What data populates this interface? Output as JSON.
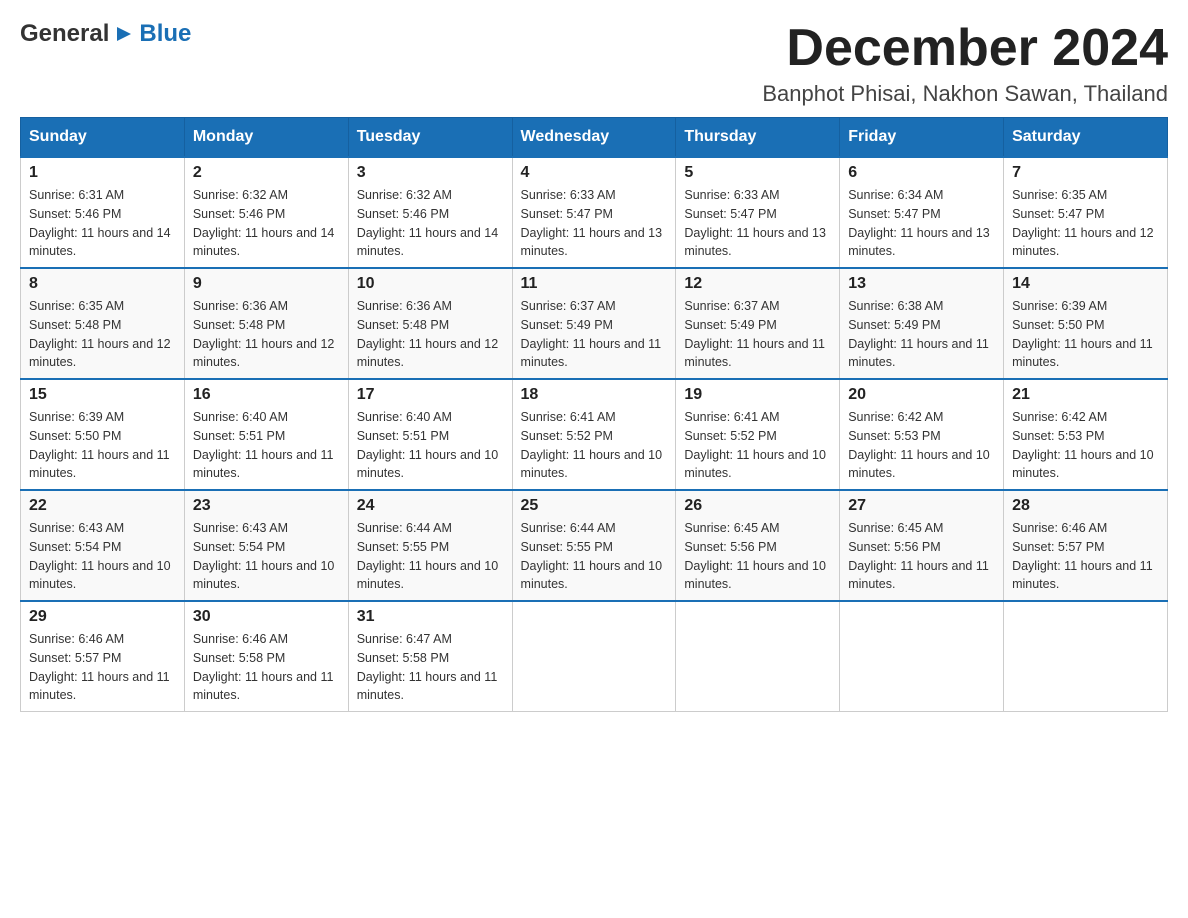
{
  "header": {
    "logo_general": "General",
    "logo_triangle": "▶",
    "logo_blue": "Blue",
    "month_title": "December 2024",
    "location": "Banphot Phisai, Nakhon Sawan, Thailand"
  },
  "days_of_week": [
    "Sunday",
    "Monday",
    "Tuesday",
    "Wednesday",
    "Thursday",
    "Friday",
    "Saturday"
  ],
  "weeks": [
    [
      {
        "day": "1",
        "sunrise": "6:31 AM",
        "sunset": "5:46 PM",
        "daylight": "11 hours and 14 minutes."
      },
      {
        "day": "2",
        "sunrise": "6:32 AM",
        "sunset": "5:46 PM",
        "daylight": "11 hours and 14 minutes."
      },
      {
        "day": "3",
        "sunrise": "6:32 AM",
        "sunset": "5:46 PM",
        "daylight": "11 hours and 14 minutes."
      },
      {
        "day": "4",
        "sunrise": "6:33 AM",
        "sunset": "5:47 PM",
        "daylight": "11 hours and 13 minutes."
      },
      {
        "day": "5",
        "sunrise": "6:33 AM",
        "sunset": "5:47 PM",
        "daylight": "11 hours and 13 minutes."
      },
      {
        "day": "6",
        "sunrise": "6:34 AM",
        "sunset": "5:47 PM",
        "daylight": "11 hours and 13 minutes."
      },
      {
        "day": "7",
        "sunrise": "6:35 AM",
        "sunset": "5:47 PM",
        "daylight": "11 hours and 12 minutes."
      }
    ],
    [
      {
        "day": "8",
        "sunrise": "6:35 AM",
        "sunset": "5:48 PM",
        "daylight": "11 hours and 12 minutes."
      },
      {
        "day": "9",
        "sunrise": "6:36 AM",
        "sunset": "5:48 PM",
        "daylight": "11 hours and 12 minutes."
      },
      {
        "day": "10",
        "sunrise": "6:36 AM",
        "sunset": "5:48 PM",
        "daylight": "11 hours and 12 minutes."
      },
      {
        "day": "11",
        "sunrise": "6:37 AM",
        "sunset": "5:49 PM",
        "daylight": "11 hours and 11 minutes."
      },
      {
        "day": "12",
        "sunrise": "6:37 AM",
        "sunset": "5:49 PM",
        "daylight": "11 hours and 11 minutes."
      },
      {
        "day": "13",
        "sunrise": "6:38 AM",
        "sunset": "5:49 PM",
        "daylight": "11 hours and 11 minutes."
      },
      {
        "day": "14",
        "sunrise": "6:39 AM",
        "sunset": "5:50 PM",
        "daylight": "11 hours and 11 minutes."
      }
    ],
    [
      {
        "day": "15",
        "sunrise": "6:39 AM",
        "sunset": "5:50 PM",
        "daylight": "11 hours and 11 minutes."
      },
      {
        "day": "16",
        "sunrise": "6:40 AM",
        "sunset": "5:51 PM",
        "daylight": "11 hours and 11 minutes."
      },
      {
        "day": "17",
        "sunrise": "6:40 AM",
        "sunset": "5:51 PM",
        "daylight": "11 hours and 10 minutes."
      },
      {
        "day": "18",
        "sunrise": "6:41 AM",
        "sunset": "5:52 PM",
        "daylight": "11 hours and 10 minutes."
      },
      {
        "day": "19",
        "sunrise": "6:41 AM",
        "sunset": "5:52 PM",
        "daylight": "11 hours and 10 minutes."
      },
      {
        "day": "20",
        "sunrise": "6:42 AM",
        "sunset": "5:53 PM",
        "daylight": "11 hours and 10 minutes."
      },
      {
        "day": "21",
        "sunrise": "6:42 AM",
        "sunset": "5:53 PM",
        "daylight": "11 hours and 10 minutes."
      }
    ],
    [
      {
        "day": "22",
        "sunrise": "6:43 AM",
        "sunset": "5:54 PM",
        "daylight": "11 hours and 10 minutes."
      },
      {
        "day": "23",
        "sunrise": "6:43 AM",
        "sunset": "5:54 PM",
        "daylight": "11 hours and 10 minutes."
      },
      {
        "day": "24",
        "sunrise": "6:44 AM",
        "sunset": "5:55 PM",
        "daylight": "11 hours and 10 minutes."
      },
      {
        "day": "25",
        "sunrise": "6:44 AM",
        "sunset": "5:55 PM",
        "daylight": "11 hours and 10 minutes."
      },
      {
        "day": "26",
        "sunrise": "6:45 AM",
        "sunset": "5:56 PM",
        "daylight": "11 hours and 10 minutes."
      },
      {
        "day": "27",
        "sunrise": "6:45 AM",
        "sunset": "5:56 PM",
        "daylight": "11 hours and 11 minutes."
      },
      {
        "day": "28",
        "sunrise": "6:46 AM",
        "sunset": "5:57 PM",
        "daylight": "11 hours and 11 minutes."
      }
    ],
    [
      {
        "day": "29",
        "sunrise": "6:46 AM",
        "sunset": "5:57 PM",
        "daylight": "11 hours and 11 minutes."
      },
      {
        "day": "30",
        "sunrise": "6:46 AM",
        "sunset": "5:58 PM",
        "daylight": "11 hours and 11 minutes."
      },
      {
        "day": "31",
        "sunrise": "6:47 AM",
        "sunset": "5:58 PM",
        "daylight": "11 hours and 11 minutes."
      },
      null,
      null,
      null,
      null
    ]
  ]
}
